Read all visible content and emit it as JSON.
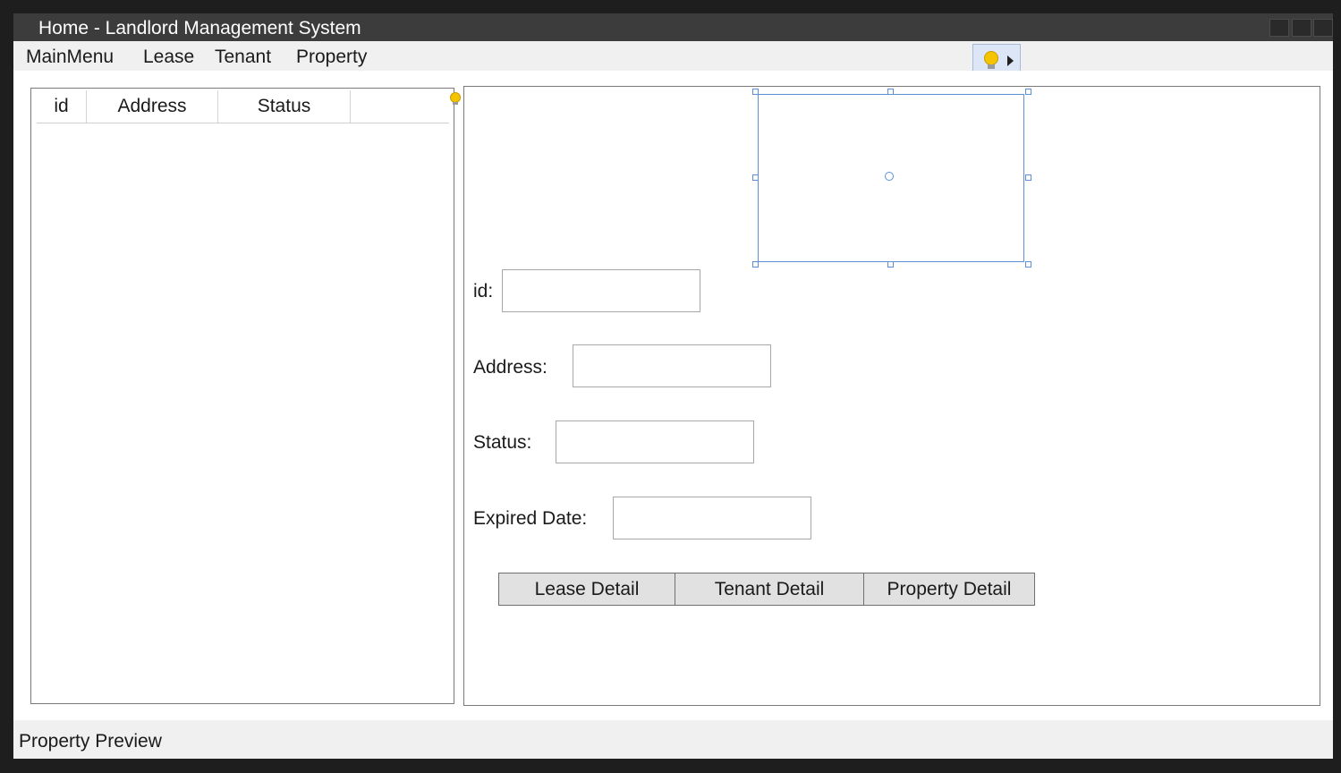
{
  "window": {
    "title": "Home - Landlord Management System"
  },
  "menu": {
    "items": [
      {
        "label": "MainMenu"
      },
      {
        "label": "Lease"
      },
      {
        "label": "Tenant"
      },
      {
        "label": "Property"
      }
    ]
  },
  "list": {
    "columns": [
      "id",
      "Address",
      "Status"
    ],
    "rows": []
  },
  "detail": {
    "image": {
      "state": "empty"
    },
    "fields": [
      {
        "label": "id:",
        "value": ""
      },
      {
        "label": "Address:",
        "value": ""
      },
      {
        "label": "Status:",
        "value": ""
      },
      {
        "label": "Expired Date:",
        "value": ""
      }
    ],
    "buttons": [
      {
        "label": "Lease Detail"
      },
      {
        "label": "Tenant Detail"
      },
      {
        "label": "Property Detail"
      }
    ]
  },
  "statusbar": {
    "text": "Property Preview"
  },
  "icons": {
    "lightbulb": "lightbulb-icon",
    "arrow": "arrow-right-icon"
  },
  "colors": {
    "titlebar": "#3c3c3c",
    "selection": "#5b8fd6",
    "button": "#e1e1e1",
    "bulb": "#f5c400"
  }
}
